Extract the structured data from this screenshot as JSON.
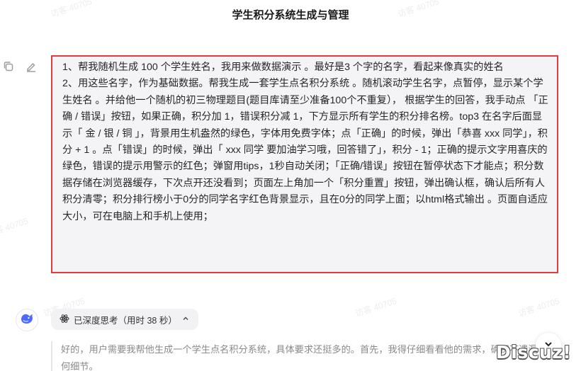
{
  "header": {
    "title": "学生积分系统生成与管理"
  },
  "watermark": {
    "text": "访客 40705"
  },
  "user_message": {
    "text": "1、帮我随机生成 100 个学生姓名，我用来做数据演示 。最好是3 个字的名字，看起来像真实的姓名\n2、用这些名字，作为基础数据。帮我生成一套学生点名积分系统 。随机滚动学生名字，点暂停，显示某个学生姓名 。并给他一个随机的初三物理题目(题目库请至少准备100个不重复）， 根据学生的回答，我手动点 「正确 / 错误」按钮，如果正确，积分加 1，错误积分减 1，下方显示所有学生的积分排名榜。top3 在名字后面显示「 金 / 银 / 铜 」，背景用生机盎然的绿色，字体用免费字体；点「正确」的时候，弹出「恭喜 xxx 同学」，积分 + 1 。点「错误」的时候，弹出「 xxx 同学 要加油学习哦，回答错了」，积分 - 1；正确的提示文字用喜庆的绿色，错误的提示用警示的红色；弹窗用tips，1秒自动关闭；「正确/错误」按钮在暂停状态下才能点；积分数据存储在浏览器缓存，下次点开还没看到；页面左上角加一个「积分重置」按钮，弹出确认框，确认后所有人积分清零；积分排行榜小于0分的同学名字红色背景显示，且在0分的同学上面；以html格式输出 。页面自适应大小，可在电脑上和手机上使用；",
    "highlight_color": "#e23b3b"
  },
  "thinking": {
    "label": "已深度思考（用时 38 秒）"
  },
  "answer": {
    "text": "好的，用户需要我帮他生成一个学生点名积分系统，具体要求还挺多的。首先，我得仔细看看他的需求，确保不遗漏任何细节。"
  },
  "brand": {
    "logo_text": "Discuz!"
  },
  "icons": {
    "copy": "copy-icon",
    "edit": "edit-icon",
    "assistant": "whale-icon",
    "thinking": "atom-icon",
    "collapse": "chevron-up-icon",
    "scroll": "chevron-down-icon"
  },
  "colors": {
    "accent": "#4d6bfe",
    "bubble": "#f4f4f6",
    "pill": "#f2f2f4",
    "muted_text": "#8a8a8a"
  }
}
